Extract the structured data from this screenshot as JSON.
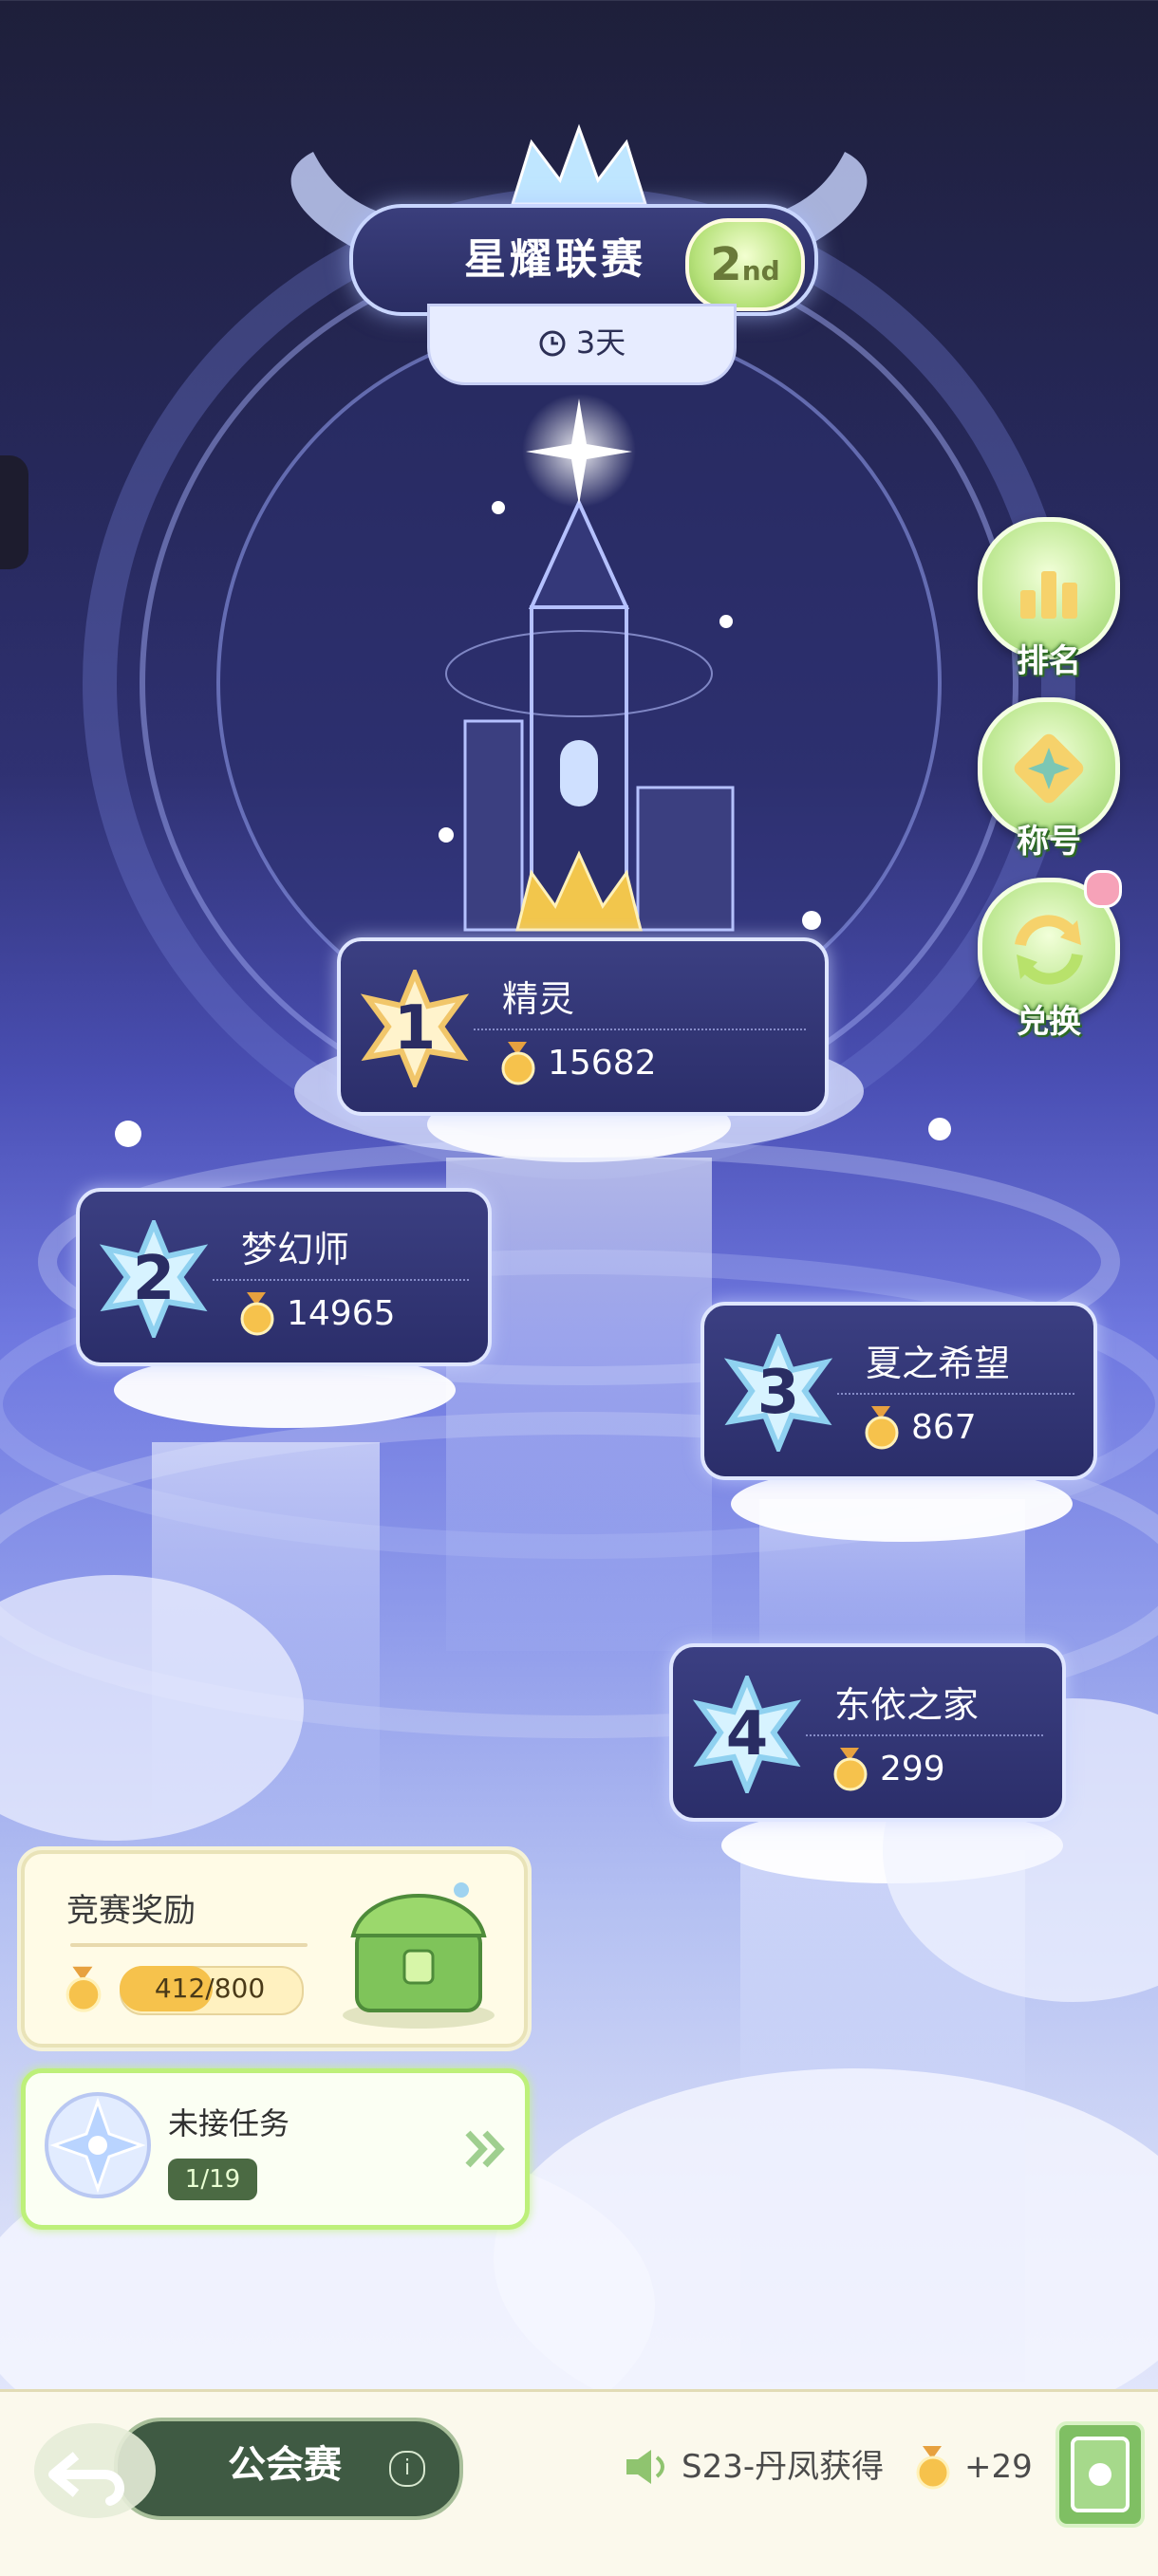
{
  "header": {
    "title": "星耀联赛",
    "season_badge": {
      "number": "2",
      "suffix": "nd"
    },
    "timer_text": "3天"
  },
  "side_menu": [
    {
      "label": "排名",
      "icon": "ranking-icon"
    },
    {
      "label": "称号",
      "icon": "title-icon"
    },
    {
      "label": "兑换",
      "icon": "exchange-icon"
    }
  ],
  "ranks": [
    {
      "rank": "1",
      "name": "精灵",
      "score": "15682"
    },
    {
      "rank": "2",
      "name": "梦幻师",
      "score": "14965"
    },
    {
      "rank": "3",
      "name": "夏之希望",
      "score": "867"
    },
    {
      "rank": "4",
      "name": "东依之家",
      "score": "299"
    }
  ],
  "reward": {
    "title": "竞赛奖励",
    "progress_text": "412/800",
    "progress_fraction": 0.515
  },
  "task": {
    "title": "未接任务",
    "count": "1/19"
  },
  "bottom_bar": {
    "guild_label": "公会赛",
    "info_symbol": "i",
    "ticker_text": "S23-丹凤获得",
    "ticker_reward": "+29"
  },
  "colors": {
    "accent_green": "#bdf07a",
    "card_navy": "#2b2e6a",
    "gold": "#f6c24c"
  }
}
